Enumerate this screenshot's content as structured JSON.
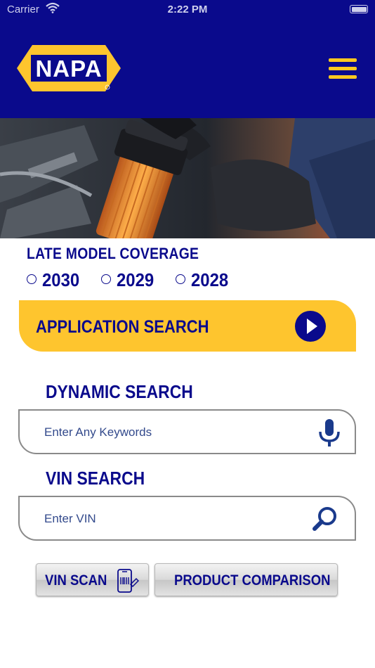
{
  "status_bar": {
    "carrier": "Carrier",
    "time": "2:22 PM"
  },
  "header": {
    "logo_text": "NAPA",
    "menu_icon": "hamburger-menu-icon"
  },
  "colors": {
    "brand_blue": "#0a0a8c",
    "brand_yellow": "#fec52e"
  },
  "coverage": {
    "title": "LATE MODEL COVERAGE",
    "years": [
      "2030",
      "2029",
      "2028"
    ]
  },
  "application_search": {
    "label": "APPLICATION SEARCH",
    "icon": "play-arrow-icon"
  },
  "dynamic_search": {
    "title": "DYNAMIC SEARCH",
    "value": "",
    "placeholder": "Enter Any Keywords",
    "icon": "microphone-icon"
  },
  "vin_search": {
    "title": "VIN SEARCH",
    "value": "",
    "placeholder": "Enter VIN",
    "icon": "magnifier-icon"
  },
  "buttons": {
    "vin_scan": "VIN SCAN",
    "vin_scan_icon": "phone-barcode-scan-icon",
    "product_comparison": "PRODUCT COMPARISON"
  }
}
